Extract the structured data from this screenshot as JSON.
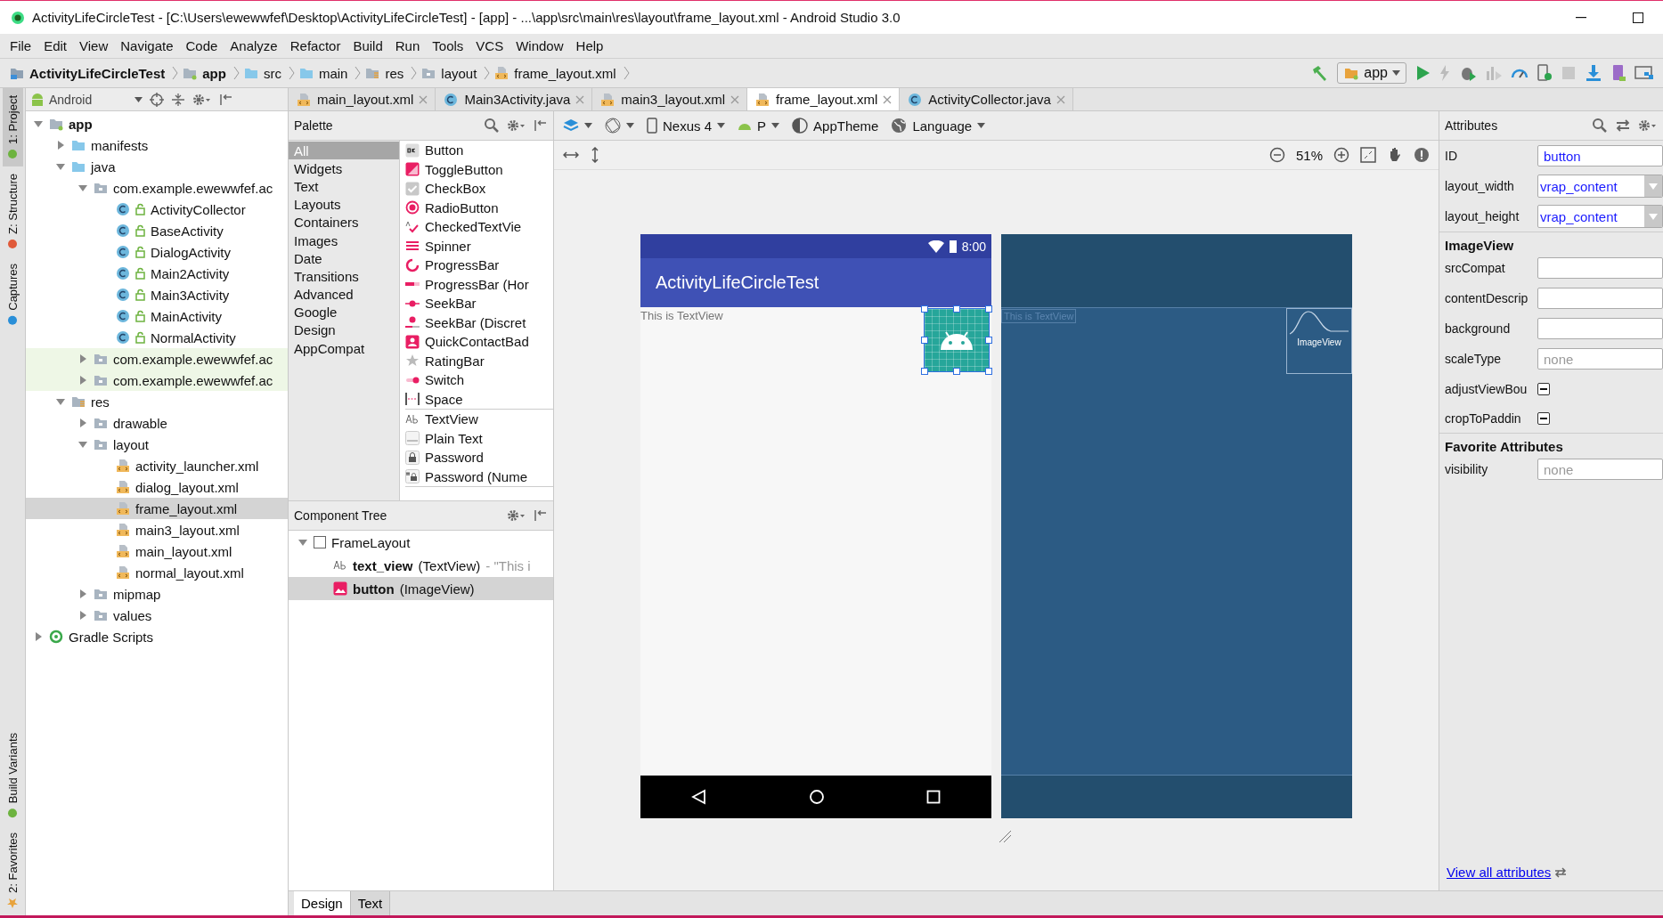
{
  "window": {
    "title": "ActivityLifeCircleTest - [C:\\Users\\ewewwfef\\Desktop\\ActivityLifeCircleTest] - [app] - ...\\app\\src\\main\\res\\layout\\frame_layout.xml - Android Studio 3.0"
  },
  "menu": [
    "File",
    "Edit",
    "View",
    "Navigate",
    "Code",
    "Analyze",
    "Refactor",
    "Build",
    "Run",
    "Tools",
    "VCS",
    "Window",
    "Help"
  ],
  "breadcrumbs": [
    {
      "label": "ActivityLifeCircleTest",
      "kind": "project"
    },
    {
      "label": "app",
      "kind": "module"
    },
    {
      "label": "src",
      "kind": "folder"
    },
    {
      "label": "main",
      "kind": "folder"
    },
    {
      "label": "res",
      "kind": "res"
    },
    {
      "label": "layout",
      "kind": "dir"
    },
    {
      "label": "frame_layout.xml",
      "kind": "xml"
    }
  ],
  "run_config": "app",
  "tool_strip": [
    {
      "label": "1: Project",
      "kind": "project",
      "selected": true
    },
    {
      "label": "Z: Structure",
      "kind": "structure",
      "selected": false
    },
    {
      "label": "Captures",
      "kind": "captures",
      "selected": false
    },
    {
      "label": "Build Variants",
      "kind": "variants",
      "selected": false
    },
    {
      "label": "2: Favorites",
      "kind": "favorites",
      "selected": false
    }
  ],
  "project_view": "Android",
  "project_tree": [
    {
      "label": "app",
      "kind": "module",
      "expanded": true,
      "selected": false,
      "children": [
        {
          "label": "manifests",
          "kind": "folder",
          "expanded": false,
          "selected": false
        },
        {
          "label": "java",
          "kind": "folder",
          "expanded": true,
          "selected": false,
          "children": [
            {
              "label": "com.example.ewewwfef.ac",
              "kind": "package",
              "expanded": true,
              "selected": false,
              "children": [
                {
                  "label": "ActivityCollector",
                  "kind": "class",
                  "selected": false
                },
                {
                  "label": "BaseActivity",
                  "kind": "class",
                  "selected": false
                },
                {
                  "label": "DialogActivity",
                  "kind": "class",
                  "selected": false
                },
                {
                  "label": "Main2Activity",
                  "kind": "class",
                  "selected": false
                },
                {
                  "label": "Main3Activity",
                  "kind": "class",
                  "selected": false
                },
                {
                  "label": "MainActivity",
                  "kind": "class",
                  "selected": false
                },
                {
                  "label": "NormalActivity",
                  "kind": "class",
                  "selected": false
                }
              ]
            },
            {
              "label": "com.example.ewewwfef.ac",
              "kind": "test-package",
              "expanded": false,
              "selected": false
            },
            {
              "label": "com.example.ewewwfef.ac",
              "kind": "test-package",
              "expanded": false,
              "selected": false
            }
          ]
        },
        {
          "label": "res",
          "kind": "res",
          "expanded": true,
          "selected": false,
          "children": [
            {
              "label": "drawable",
              "kind": "dir",
              "expanded": false,
              "selected": false
            },
            {
              "label": "layout",
              "kind": "dir",
              "expanded": true,
              "selected": false,
              "children": [
                {
                  "label": "activity_launcher.xml",
                  "kind": "xml",
                  "selected": false
                },
                {
                  "label": "dialog_layout.xml",
                  "kind": "xml",
                  "selected": false
                },
                {
                  "label": "frame_layout.xml",
                  "kind": "xml",
                  "selected": true
                },
                {
                  "label": "main3_layout.xml",
                  "kind": "xml",
                  "selected": false
                },
                {
                  "label": "main_layout.xml",
                  "kind": "xml",
                  "selected": false
                },
                {
                  "label": "normal_layout.xml",
                  "kind": "xml",
                  "selected": false
                }
              ]
            },
            {
              "label": "mipmap",
              "kind": "dir",
              "expanded": false,
              "selected": false
            },
            {
              "label": "values",
              "kind": "dir",
              "expanded": false,
              "selected": false
            }
          ]
        }
      ]
    },
    {
      "label": "Gradle Scripts",
      "kind": "gradle",
      "expanded": false,
      "selected": false
    }
  ],
  "editor_tabs": [
    {
      "label": "main_layout.xml",
      "kind": "xml",
      "selected": false
    },
    {
      "label": "Main3Activity.java",
      "kind": "class",
      "selected": false
    },
    {
      "label": "main3_layout.xml",
      "kind": "xml",
      "selected": false
    },
    {
      "label": "frame_layout.xml",
      "kind": "xml",
      "selected": true
    },
    {
      "label": "ActivityCollector.java",
      "kind": "class",
      "selected": false
    }
  ],
  "palette": {
    "title": "Palette",
    "categories": [
      {
        "label": "All",
        "selected": true
      },
      {
        "label": "Widgets",
        "selected": false
      },
      {
        "label": "Text",
        "selected": false
      },
      {
        "label": "Layouts",
        "selected": false
      },
      {
        "label": "Containers",
        "selected": false
      },
      {
        "label": "Images",
        "selected": false
      },
      {
        "label": "Date",
        "selected": false
      },
      {
        "label": "Transitions",
        "selected": false
      },
      {
        "label": "Advanced",
        "selected": false
      },
      {
        "label": "Google",
        "selected": false
      },
      {
        "label": "Design",
        "selected": false
      },
      {
        "label": "AppCompat",
        "selected": false
      }
    ],
    "groups": [
      {
        "items": [
          {
            "label": "Button",
            "kind": "button"
          },
          {
            "label": "ToggleButton",
            "kind": "toggle"
          },
          {
            "label": "CheckBox",
            "kind": "checkbox"
          },
          {
            "label": "RadioButton",
            "kind": "radio"
          },
          {
            "label": "CheckedTextVie",
            "kind": "checked-text"
          },
          {
            "label": "Spinner",
            "kind": "spinner"
          },
          {
            "label": "ProgressBar",
            "kind": "progress"
          },
          {
            "label": "ProgressBar (Hor",
            "kind": "progress-h"
          },
          {
            "label": "SeekBar",
            "kind": "seekbar"
          },
          {
            "label": "SeekBar (Discret",
            "kind": "seekbar-d"
          },
          {
            "label": "QuickContactBad",
            "kind": "contact"
          },
          {
            "label": "RatingBar",
            "kind": "rating"
          },
          {
            "label": "Switch",
            "kind": "switch"
          },
          {
            "label": "Space",
            "kind": "space"
          }
        ]
      },
      {
        "items": [
          {
            "label": "TextView",
            "kind": "textview"
          },
          {
            "label": "Plain Text",
            "kind": "plaintext"
          },
          {
            "label": "Password",
            "kind": "password"
          },
          {
            "label": "Password (Nume",
            "kind": "password-num"
          }
        ]
      }
    ]
  },
  "component_tree": {
    "title": "Component Tree",
    "root": {
      "label": "FrameLayout",
      "expanded": true,
      "selected": false
    },
    "children": [
      {
        "id": "text_view",
        "type": "(TextView)",
        "preview": "- \"This i",
        "kind": "textview",
        "selected": false
      },
      {
        "id": "button",
        "type": "(ImageView)",
        "kind": "imageview",
        "selected": true
      }
    ]
  },
  "design_toolbar": {
    "device": "Nexus 4",
    "api": "P",
    "theme": "AppTheme",
    "language": "Language",
    "zoom": "51%"
  },
  "preview": {
    "time": "8:00",
    "app_title": "ActivityLifeCircleTest",
    "text": "This is TextView",
    "blueprint_text": "This is TextView",
    "blueprint_image": "ImageView"
  },
  "attributes": {
    "title": "Attributes",
    "top": [
      {
        "label": "ID",
        "kind": "text",
        "value": "button"
      },
      {
        "label": "layout_width",
        "kind": "dropdown",
        "value": "vrap_content"
      },
      {
        "label": "layout_height",
        "kind": "dropdown",
        "value": "vrap_content"
      }
    ],
    "sections": [
      {
        "title": "ImageView",
        "rows": [
          {
            "label": "srcCompat",
            "kind": "text"
          },
          {
            "label": "contentDescrip",
            "kind": "text"
          },
          {
            "label": "background",
            "kind": "text"
          },
          {
            "label": "scaleType",
            "kind": "text",
            "placeholder": "none"
          },
          {
            "label": "adjustViewBou",
            "kind": "checkbox",
            "indeterminate": true
          },
          {
            "label": "cropToPaddin",
            "kind": "checkbox",
            "indeterminate": true
          }
        ]
      },
      {
        "title": "Favorite Attributes",
        "rows": [
          {
            "label": "visibility",
            "kind": "text",
            "placeholder": "none"
          }
        ]
      }
    ],
    "link": "View all attributes"
  },
  "bottom_tabs": [
    {
      "label": "Design",
      "selected": true
    },
    {
      "label": "Text",
      "selected": false
    }
  ]
}
